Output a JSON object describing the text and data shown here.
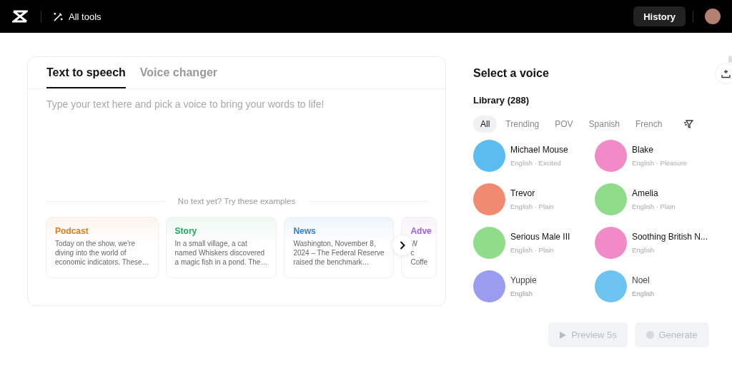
{
  "header": {
    "tools_label": "All tools",
    "history_button": "History"
  },
  "editor": {
    "tabs": [
      {
        "label": "Text to speech",
        "selected": true
      },
      {
        "label": "Voice changer",
        "selected": false
      }
    ],
    "placeholder": "Type your text here and pick a voice to bring your words to life!",
    "examples_heading": "No text yet? Try these examples",
    "examples": [
      {
        "title": "Podcast",
        "color": "#e07a1f",
        "lines": [
          "Today on the show, we're",
          "diving into the world of",
          "economic indicators. These…"
        ]
      },
      {
        "title": "Story",
        "color": "#1faa5a",
        "lines": [
          "In a small village, a cat",
          "named Whiskers discovered",
          "a magic fish in a pond. The…"
        ]
      },
      {
        "title": "News",
        "color": "#2f7fd8",
        "lines": [
          "Washington, November 8,",
          "2024 – The Federal Reserve",
          "raised the benchmark…"
        ]
      },
      {
        "title": "Adve",
        "color": "#a25ee0",
        "lines": [
          "W",
          "c",
          "Coffe"
        ]
      }
    ]
  },
  "voices": {
    "title": "Select a voice",
    "library": "Library (288)",
    "filters": [
      {
        "label": "All",
        "selected": true
      },
      {
        "label": "Trending",
        "selected": false
      },
      {
        "label": "POV",
        "selected": false
      },
      {
        "label": "Spanish",
        "selected": false
      },
      {
        "label": "French",
        "selected": false
      }
    ],
    "items": [
      {
        "name": "Michael Mouse",
        "detail": "English · Excited",
        "color": "#5bbcf0",
        "faded": false
      },
      {
        "name": "Blake",
        "detail": "English · Pleasure",
        "color": "#f28ac7",
        "faded": false
      },
      {
        "name": "Trevor",
        "detail": "English · Plain",
        "color": "#f08a70",
        "faded": false
      },
      {
        "name": "Amelia",
        "detail": "English · Plain",
        "color": "#8fdc8a",
        "faded": false
      },
      {
        "name": "Serious Male III",
        "detail": "English · Plain",
        "color": "#8fdc8a",
        "faded": false
      },
      {
        "name": "Soothing British N...",
        "detail": "English",
        "color": "#f28ac7",
        "faded": false
      },
      {
        "name": "Yuppie",
        "detail": "English",
        "color": "#9a9cf0",
        "faded": true
      },
      {
        "name": "Noel",
        "detail": "English",
        "color": "#6ec4f0",
        "faded": true
      }
    ],
    "buttons": [
      {
        "kind": "preview",
        "label": "Preview 5s",
        "disabled": true
      },
      {
        "kind": "generate",
        "label": "Generate",
        "disabled": true
      }
    ]
  }
}
